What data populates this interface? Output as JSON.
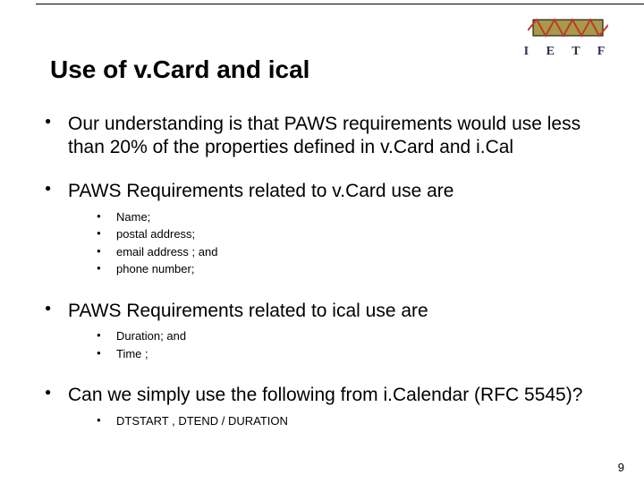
{
  "logo": {
    "text": "I E T F"
  },
  "title": "Use of  v.Card and ical",
  "bullets": {
    "b1": "Our understanding is that PAWS requirements would use less than 20% of the properties defined in v.Card and i.Cal",
    "b2": "PAWS Requirements related to v.Card use are",
    "b2sub": {
      "s1": "Name;",
      "s2": "postal address;",
      "s3": "email address ; and",
      "s4": "phone number;"
    },
    "b3": "PAWS Requirements related to ical use are",
    "b3sub": {
      "s1": "Duration; and",
      "s2": "Time ;"
    },
    "b4": "Can we simply use the following from i.Calendar  (RFC 5545)?",
    "b4sub": {
      "s1": "DTSTART , DTEND / DURATION"
    }
  },
  "page_number": "9"
}
